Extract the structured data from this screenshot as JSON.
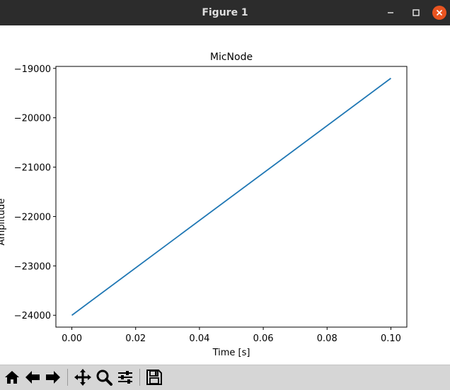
{
  "window": {
    "title": "Figure 1",
    "close_color": "#e95420"
  },
  "toolbar": {
    "buttons": [
      "home-icon",
      "back-arrow-icon",
      "forward-arrow-icon",
      "pan-icon",
      "zoom-icon",
      "subplots-config-icon",
      "save-icon"
    ],
    "status": ""
  },
  "chart_data": {
    "type": "line",
    "title": "MicNode",
    "xlabel": "Time [s]",
    "ylabel": "Amplitude",
    "x": [
      0.0,
      0.1
    ],
    "series": [
      {
        "color": "#1f77b4",
        "values": [
          -24000,
          -19200
        ]
      }
    ],
    "xlim": [
      -0.005,
      0.105
    ],
    "ylim": [
      -24240,
      -18960
    ],
    "xticks": [
      0.0,
      0.02,
      0.04,
      0.06,
      0.08,
      0.1
    ],
    "xtick_labels": [
      "0.00",
      "0.02",
      "0.04",
      "0.06",
      "0.08",
      "0.10"
    ],
    "yticks": [
      -24000,
      -23000,
      -22000,
      -21000,
      -20000,
      -19000
    ],
    "ytick_labels": [
      "−24000",
      "−23000",
      "−22000",
      "−21000",
      "−20000",
      "−19000"
    ],
    "grid": false
  }
}
